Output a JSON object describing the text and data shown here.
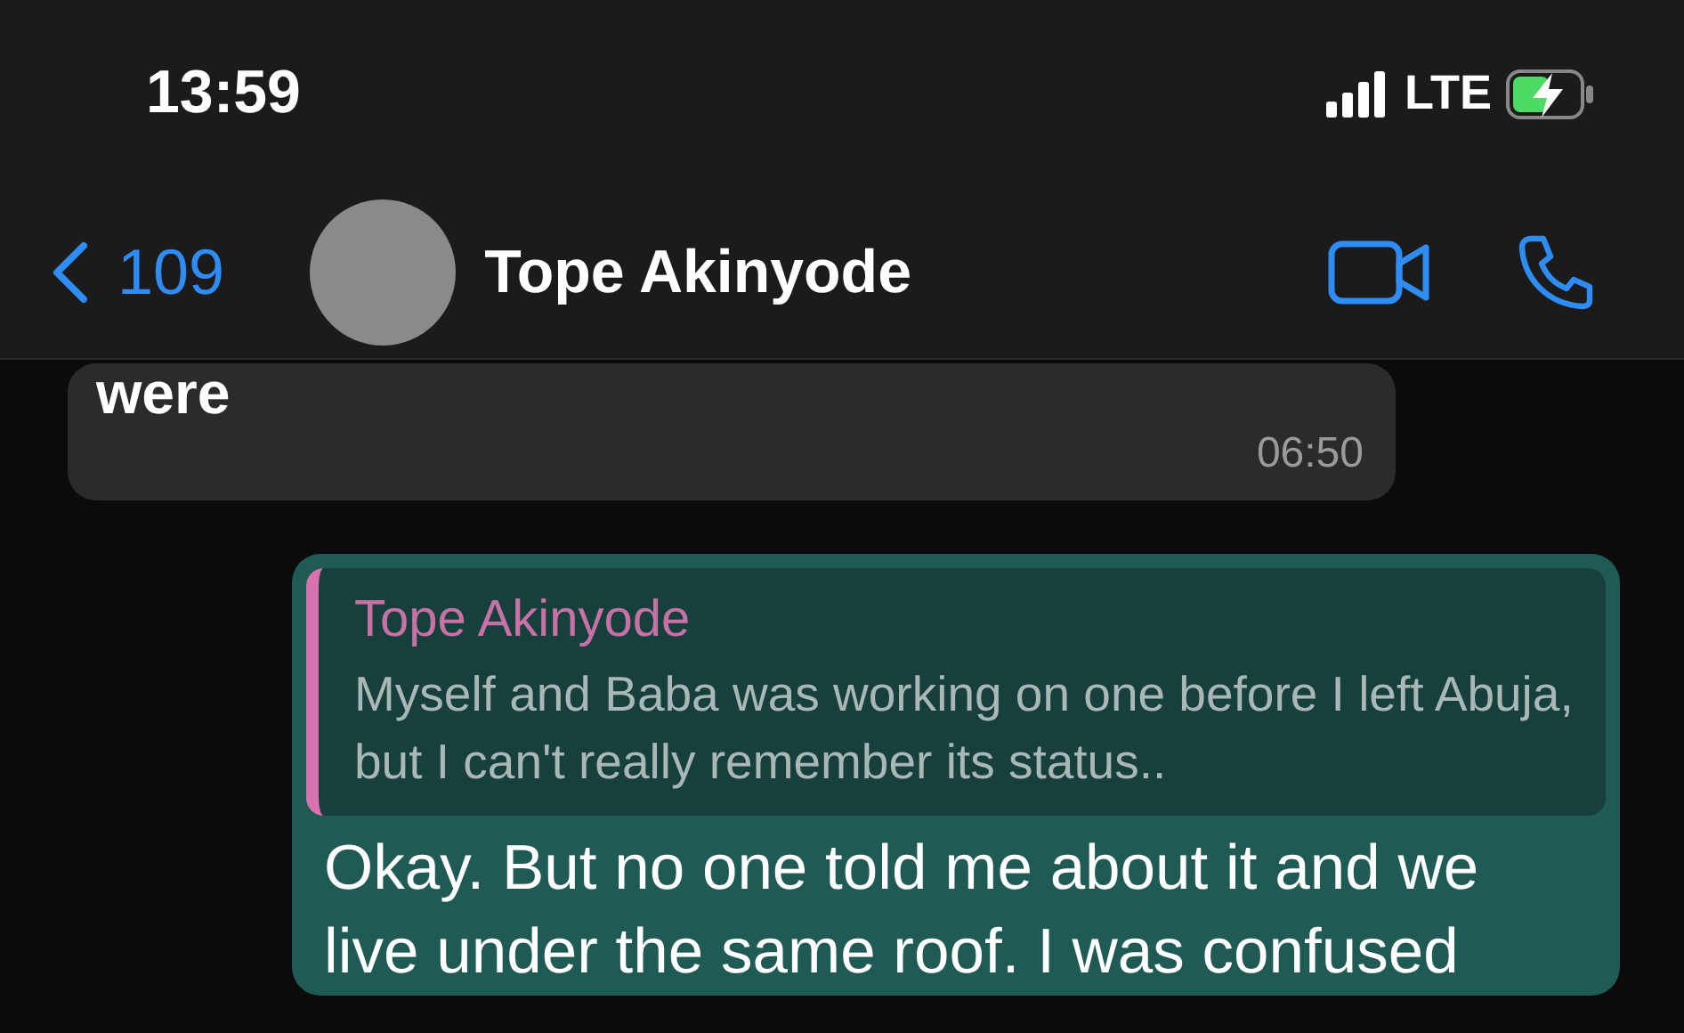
{
  "status_bar": {
    "time": "13:59",
    "network": "LTE",
    "charging": true
  },
  "header": {
    "back_count": "109",
    "contact_name": "Tope Akinyode"
  },
  "messages": [
    {
      "kind": "incoming",
      "text": "were",
      "time": "06:50"
    },
    {
      "kind": "outgoing",
      "quote": {
        "author": "Tope Akinyode",
        "text": "Myself and Baba was working on one before I left Abuja, but I can't really remember its status.."
      },
      "text": "Okay. But no one told me about it and we live under the same roof. I was confused"
    }
  ]
}
